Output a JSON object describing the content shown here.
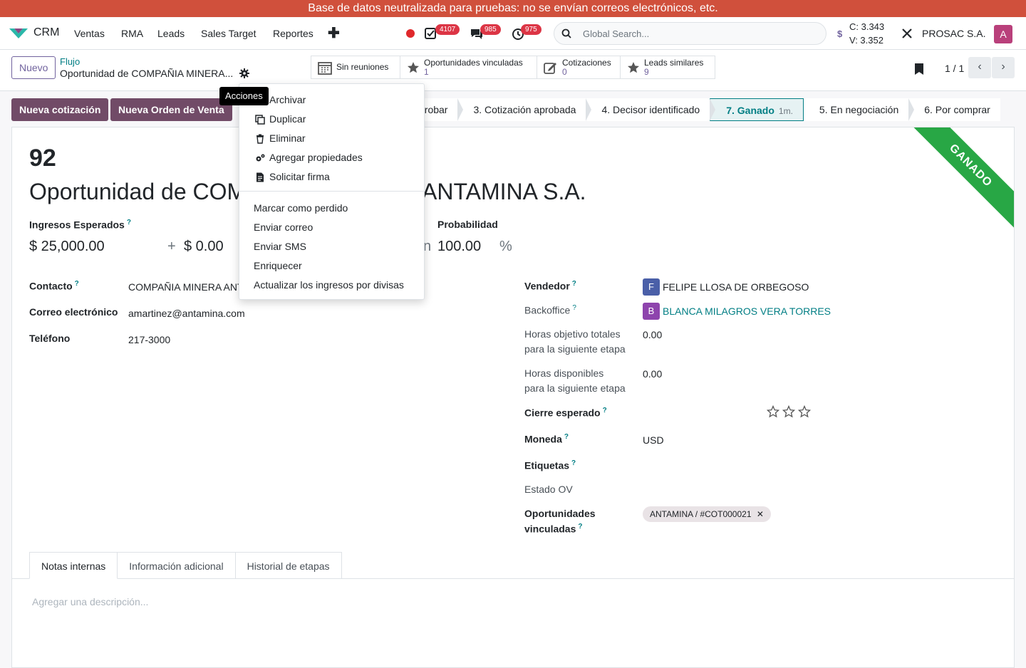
{
  "banner": "Base de datos neutralizada para pruebas: no se envían correos electrónicos, etc.",
  "nav": {
    "app": "CRM",
    "menu": [
      "Ventas",
      "RMA",
      "Leads",
      "Sales Target",
      "Reportes"
    ],
    "activity_count": "4107",
    "message_count": "985",
    "timer_count": "975",
    "search_placeholder": "Global Search...",
    "rate_c": "C: 3.343",
    "rate_v": "V: 3.352",
    "company": "PROSAC S.A.",
    "user_initial": "A"
  },
  "control": {
    "new_label": "Nuevo",
    "breadcrumb_parent": "Flujo",
    "breadcrumb_current": "Oportunidad de COMPAÑIA MINERA...",
    "smart_buttons": [
      {
        "label": "Sin reuniones",
        "value": ""
      },
      {
        "label": "Oportunidades vinculadas",
        "value": "1"
      },
      {
        "label": "Cotizaciones",
        "value": "0"
      },
      {
        "label": "Leads similares",
        "value": "9"
      }
    ],
    "pager": "1 / 1"
  },
  "actions": {
    "new_quote": "Nueva cotización",
    "new_order": "Nueva Orden de Venta"
  },
  "stages": [
    {
      "label": "probar",
      "active": false
    },
    {
      "label": "3. Cotización aprobada",
      "active": false
    },
    {
      "label": "4. Decisor identificado",
      "active": false
    },
    {
      "label": "7. Ganado",
      "active": true,
      "time": "1m."
    },
    {
      "label": "5. En negociación",
      "active": false
    },
    {
      "label": "6. Por comprar",
      "active": false
    }
  ],
  "record": {
    "id": "92",
    "name_left": "Oportunidad de COM",
    "name_right": "ANTAMINA S.A.",
    "ribbon": "GANADO",
    "expected_revenue_label": "Ingresos Esperados",
    "expected_revenue": "$ 25,000.00",
    "recurring_plus": "+",
    "recurring_revenue": "$ 0.00",
    "probability_prefix": "n",
    "probability_label": "Probabilidad",
    "probability": "100.00",
    "probability_unit": "%",
    "contact_label": "Contacto",
    "contact": "COMPAÑIA MINERA ANT",
    "email_label": "Correo electrónico",
    "email": "amartinez@antamina.com",
    "phone_label": "Teléfono",
    "phone": "217-3000",
    "salesperson_label": "Vendedor",
    "salesperson_initial": "F",
    "salesperson": "FELIPE LLOSA DE ORBEGOSO",
    "backoffice_label": "Backoffice",
    "backoffice_initial": "B",
    "backoffice": "BLANCA MILAGROS VERA TORRES",
    "hours_target_label_1": "Horas objetivo totales",
    "hours_target_label_2": "para la siguiente etapa",
    "hours_target": "0.00",
    "hours_avail_label_1": "Horas disponibles",
    "hours_avail_label_2": "para la siguiente etapa",
    "hours_avail": "0.00",
    "expected_close_label": "Cierre esperado",
    "currency_label": "Moneda",
    "currency": "USD",
    "tags_label": "Etiquetas",
    "so_state_label": "Estado OV",
    "linked_label_1": "Oportunidades",
    "linked_label_2": "vinculadas",
    "linked_tag": "ANTAMINA / #COT000021",
    "priority_stars": 0
  },
  "tabs": [
    "Notas internas",
    "Información adicional",
    "Historial de etapas"
  ],
  "notes_placeholder": "Agregar una descripción...",
  "dropdown": {
    "tooltip": "Acciones",
    "items_top": [
      "Archivar",
      "Duplicar",
      "Eliminar",
      "Agregar propiedades",
      "Solicitar firma"
    ],
    "items_bottom": [
      "Marcar como perdido",
      "Enviar correo",
      "Enviar SMS",
      "Enriquecer",
      "Actualizar los ingresos por divisas"
    ]
  },
  "colors": {
    "banner": "#d0503c",
    "primary": "#714b67",
    "link": "#017e84",
    "ribbon": "#28a745"
  }
}
